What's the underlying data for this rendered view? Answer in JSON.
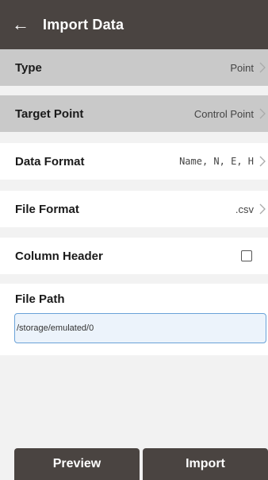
{
  "appbar": {
    "title": "Import Data",
    "back_icon": "arrow-left-icon"
  },
  "rows": [
    {
      "label": "Type",
      "value": "Point"
    },
    {
      "label": "Target Point",
      "value": "Control Point"
    },
    {
      "label": "Data Format",
      "value": "Name, N, E, H"
    },
    {
      "label": "File Format",
      "value": ".csv"
    }
  ],
  "column_header": {
    "label": "Column Header",
    "checked": false
  },
  "file_path": {
    "label": "File Path",
    "value": "/storage/emulated/0"
  },
  "buttons": {
    "preview": "Preview",
    "import": "Import"
  },
  "colors": {
    "appbar": "#4a4441",
    "gray_row": "#c9c9c9",
    "input_border": "#6aa2d8"
  }
}
